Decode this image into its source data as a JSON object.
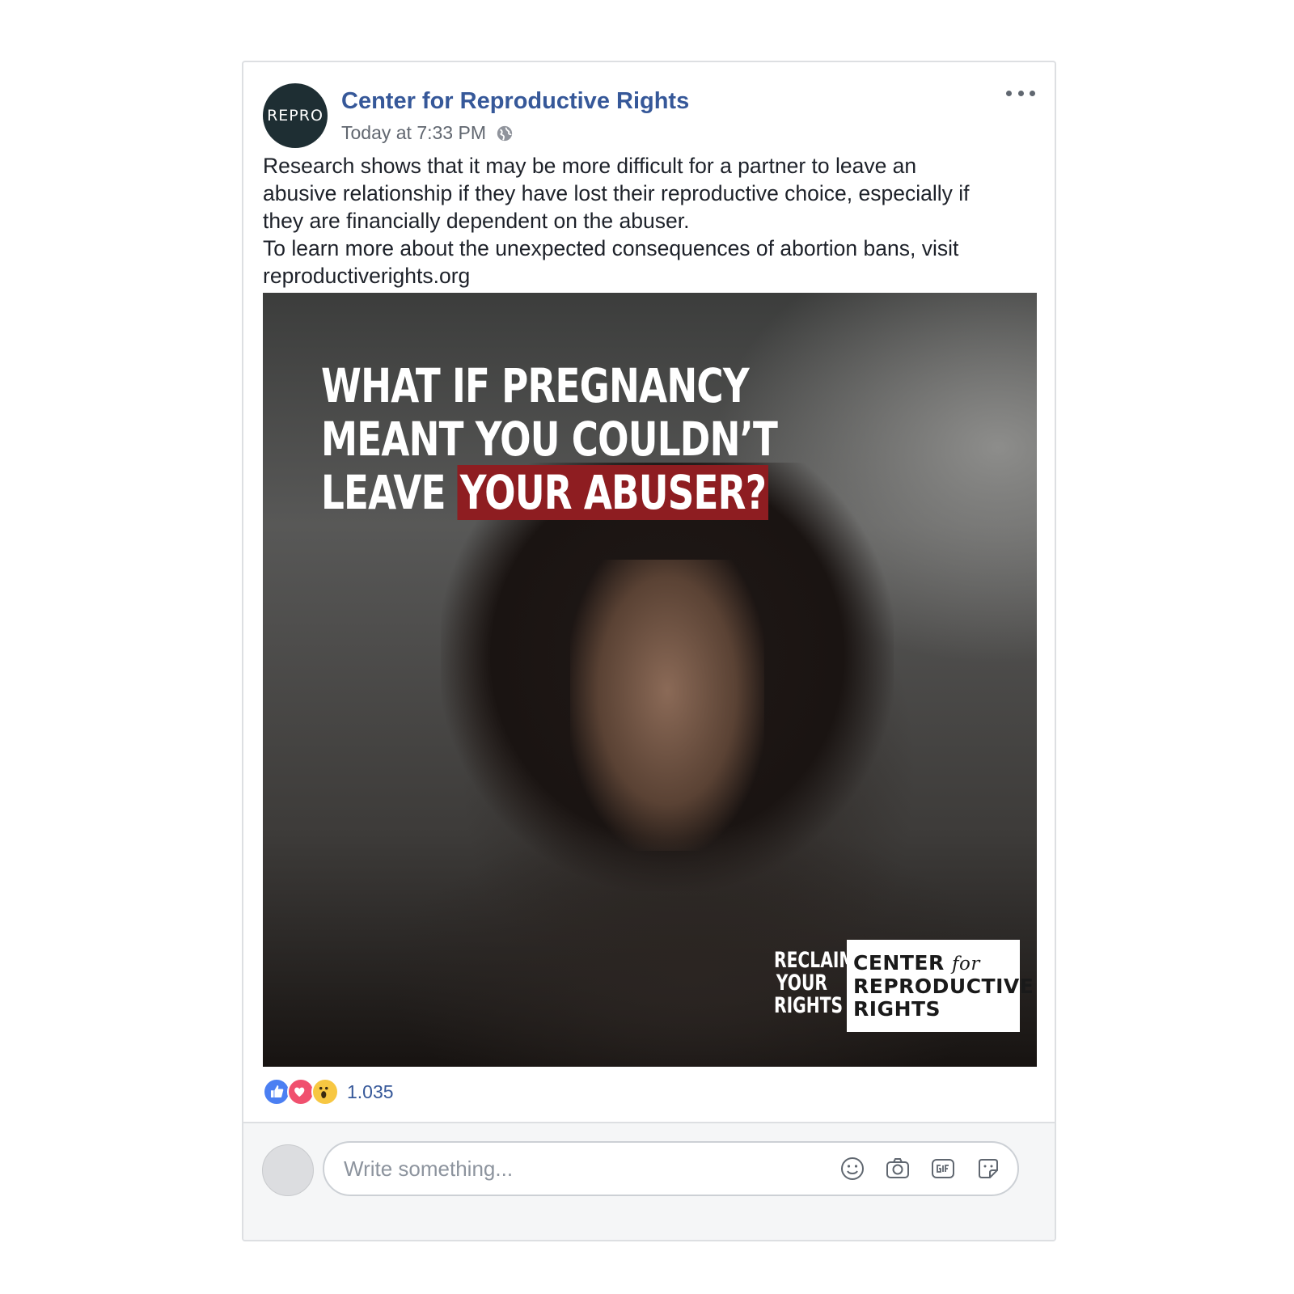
{
  "post": {
    "page_name": "Center for Reproductive Rights",
    "avatar_text": "REPRO",
    "timestamp": "Today at 7:33 PM",
    "privacy_icon": "globe-icon",
    "menu_icon": "more-options-icon",
    "text_lines": [
      "Research shows that it may be more difficult for a partner to leave an",
      "abusive relationship if they have lost their reproductive choice, especially if",
      "they are financially dependent on the abuser.",
      "To learn more about the unexpected consequences of abortion bans, visit",
      "reproductiverights.org"
    ]
  },
  "image": {
    "headline_line1": "WHAT IF PREGNANCY",
    "headline_line2": "MEANT YOU COULDN’T",
    "headline_line3_plain": "LEAVE",
    "headline_line3_highlight": "YOUR ABUSER?",
    "highlight_color": "#8e1d21",
    "reclaim_lines": [
      "RECLAIM",
      "YOUR",
      "RIGHTS"
    ],
    "org_line1": "CENTER",
    "org_for": "for",
    "org_line2": "REPRODUCTIVE",
    "org_line3": "RIGHTS"
  },
  "reactions": {
    "types": [
      "like",
      "love",
      "wow"
    ],
    "count": "1.035"
  },
  "comment": {
    "placeholder": "Write something...",
    "icons": [
      "emoji-icon",
      "camera-icon",
      "gif-icon",
      "sticker-icon"
    ]
  },
  "colors": {
    "link": "#365899",
    "like": "#4b7ff2",
    "love": "#f0506e",
    "wow": "#f7c742"
  }
}
